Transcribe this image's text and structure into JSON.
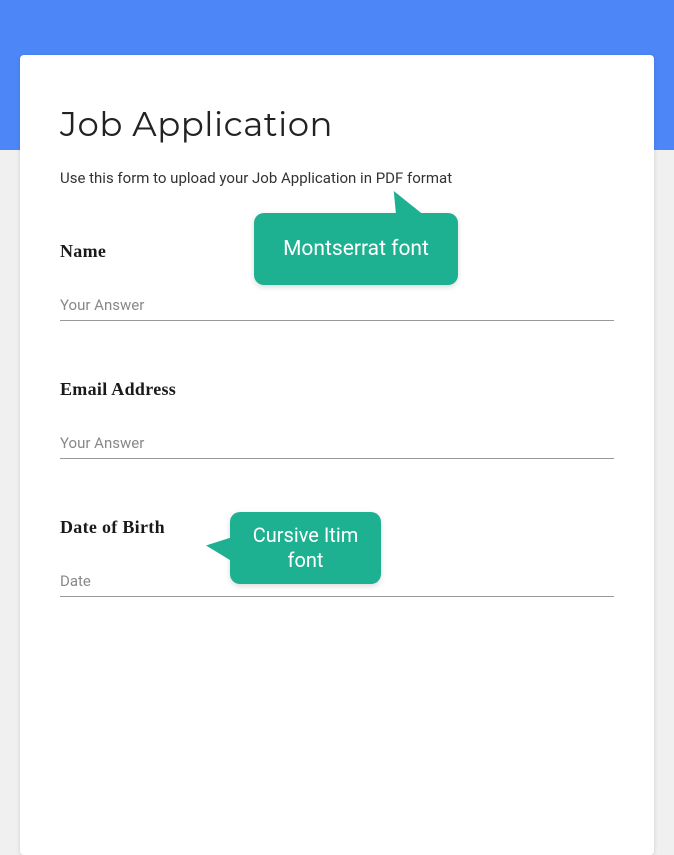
{
  "banner": {},
  "form": {
    "title": "Job Application",
    "subtitle": "Use this form to upload your Job Application in PDF format",
    "fields": {
      "name": {
        "label": "Name",
        "placeholder": "Your Answer"
      },
      "email": {
        "label": "Email Address",
        "placeholder": "Your Answer"
      },
      "dob": {
        "label": "Date of Birth",
        "placeholder": "Date"
      }
    }
  },
  "callouts": {
    "c1": "Montserrat font",
    "c2": "Cursive Itim font"
  }
}
